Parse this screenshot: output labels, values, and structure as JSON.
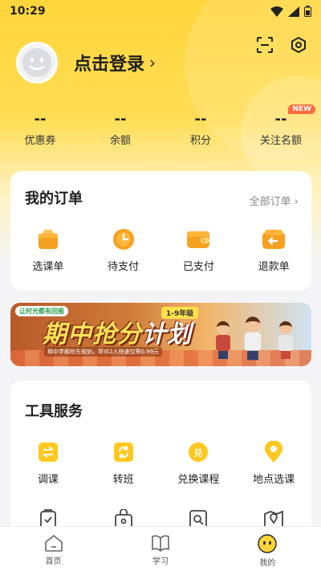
{
  "status_bar": {
    "time": "10:29"
  },
  "profile": {
    "login_text": "点击登录"
  },
  "stats": [
    {
      "value": "--",
      "label": "优惠券"
    },
    {
      "value": "--",
      "label": "余额"
    },
    {
      "value": "--",
      "label": "积分"
    },
    {
      "value": "--",
      "label": "关注名额",
      "badge": "NEW"
    }
  ],
  "orders": {
    "title": "我的订单",
    "all_link": "全部订单",
    "items": [
      {
        "label": "选课单",
        "icon": "bag-icon"
      },
      {
        "label": "待支付",
        "icon": "clock-icon"
      },
      {
        "label": "已支付",
        "icon": "wallet-icon"
      },
      {
        "label": "退款单",
        "icon": "refund-icon"
      }
    ]
  },
  "banner": {
    "brand": "让时光都有回报",
    "grade": "1-9年级",
    "headline_a": "期中抢分",
    "headline_b": "计划",
    "subtitle": "期中学期抢先规划，帮对2人快速仅需0.99元"
  },
  "tools": {
    "title": "工具服务",
    "items": [
      {
        "label": "调课",
        "icon": "swap-icon"
      },
      {
        "label": "转班",
        "icon": "transfer-icon"
      },
      {
        "label": "兑换课程",
        "icon": "exchange-icon"
      },
      {
        "label": "地点选课",
        "icon": "location-icon"
      }
    ]
  },
  "tab_bar": [
    {
      "label": "首页",
      "icon": "home-icon"
    },
    {
      "label": "学习",
      "icon": "book-icon"
    },
    {
      "label": "我的",
      "icon": "profile-face-icon"
    }
  ],
  "colors": {
    "accent": "#ffd53a",
    "icon_orange": "#f5a020",
    "icon_yellow": "#ffc81e"
  }
}
